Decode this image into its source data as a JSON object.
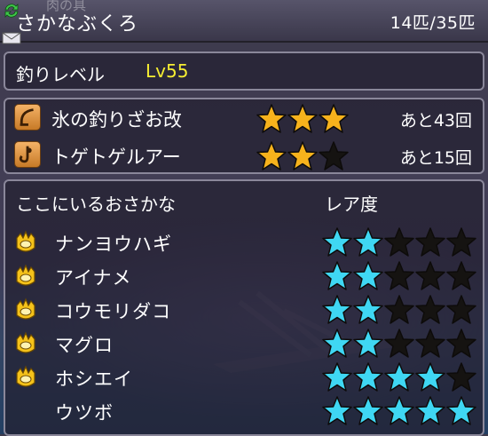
{
  "header": {
    "ghost_text": "肉の具",
    "title": "さかなぶくろ",
    "count": "14匹/35匹"
  },
  "level": {
    "label": "釣りレベル",
    "value": "Lv55"
  },
  "lures": [
    {
      "icon": "fishing-rod-icon",
      "name": "氷の釣りざお改",
      "stars_filled": 3,
      "stars_total": 3,
      "remaining": "あと43回"
    },
    {
      "icon": "lure-hook-icon",
      "name": "トゲトゲルアー",
      "stars_filled": 2,
      "stars_total": 3,
      "remaining": "あと15回"
    }
  ],
  "fish_section": {
    "heading": "ここにいるおさかな",
    "rarity_heading": "レア度"
  },
  "fish": [
    {
      "name": "ナンヨウハギ",
      "caught": true,
      "rarity": 2,
      "rarity_max": 5
    },
    {
      "name": "アイナメ",
      "caught": true,
      "rarity": 2,
      "rarity_max": 5
    },
    {
      "name": "コウモリダコ",
      "caught": true,
      "rarity": 2,
      "rarity_max": 5
    },
    {
      "name": "マグロ",
      "caught": true,
      "rarity": 2,
      "rarity_max": 5
    },
    {
      "name": "ホシエイ",
      "caught": true,
      "rarity": 4,
      "rarity_max": 5
    },
    {
      "name": "ウツボ",
      "caught": false,
      "rarity": 5,
      "rarity_max": 5
    }
  ],
  "colors": {
    "gold_star": "#f7b21c",
    "cyan_star": "#3fd7f3",
    "empty_star": "#151311",
    "level_value": "#f6ee32"
  }
}
